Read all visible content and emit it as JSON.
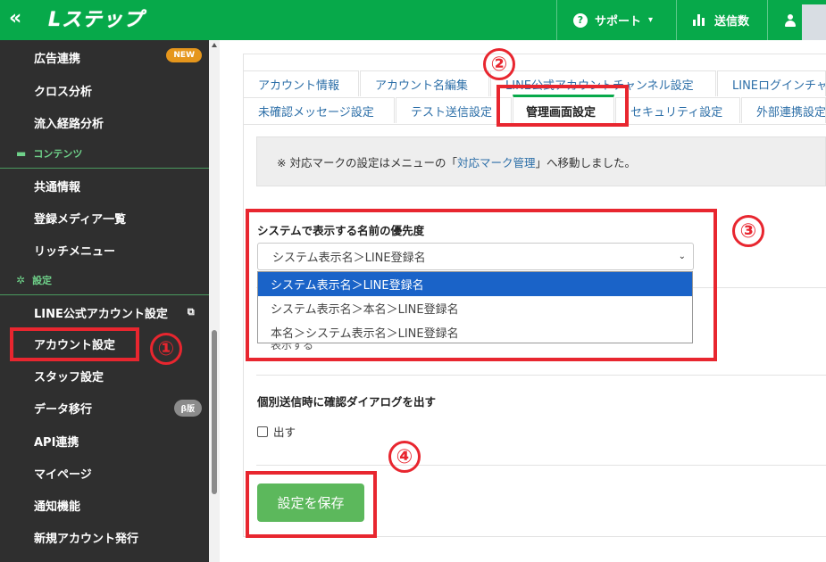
{
  "topbar": {
    "collapse": "«",
    "logo": "Lステップ",
    "support": "サポート",
    "send_count": "送信数",
    "help_glyph": "?",
    "chevron": "⌄"
  },
  "sidebar": {
    "items": [
      {
        "label": "広告連携",
        "badge": "NEW"
      },
      {
        "label": "クロス分析"
      },
      {
        "label": "流入経路分析"
      },
      {
        "label": "共通情報"
      },
      {
        "label": "登録メディア一覧"
      },
      {
        "label": "リッチメニュー"
      },
      {
        "label": "LINE公式アカウント設定"
      },
      {
        "label": "アカウント設定"
      },
      {
        "label": "スタッフ設定"
      },
      {
        "label": "データ移行",
        "badge": "β版"
      },
      {
        "label": "API連携"
      },
      {
        "label": "マイページ"
      },
      {
        "label": "通知機能"
      },
      {
        "label": "新規アカウント発行"
      }
    ],
    "sections": {
      "contents": "コンテンツ",
      "settings": "設定"
    }
  },
  "tabs": {
    "row1": [
      "アカウント情報",
      "アカウント名編集",
      "LINE公式アカウントチャンネル設定",
      "LINEログインチャ"
    ],
    "row2": [
      "未確認メッセージ設定",
      "テスト送信設定",
      "管理画面設定",
      "セキュリティ設定",
      "外部連携設定"
    ]
  },
  "notice": {
    "prefix": "※ 対応マークの設定はメニューの「",
    "link": "対応マーク管理",
    "suffix": "」へ移動しました。"
  },
  "name_priority": {
    "label": "システムで表示する名前の優先度",
    "selected": "システム表示名＞LINE登録名",
    "options": [
      "システム表示名＞LINE登録名",
      "システム表示名＞本名＞LINE登録名",
      "本名＞システム表示名＞LINE登録名"
    ],
    "hidden_text": "表示する"
  },
  "confirm_dialog": {
    "label": "個別送信時に確認ダイアログを出す",
    "checkbox_label": "出す"
  },
  "save_button": "設定を保存",
  "annotations": [
    "①",
    "②",
    "③",
    "④"
  ],
  "colors": {
    "brand": "#07a94a",
    "annotation": "#e8262f",
    "selected_option": "#1a63c8"
  }
}
